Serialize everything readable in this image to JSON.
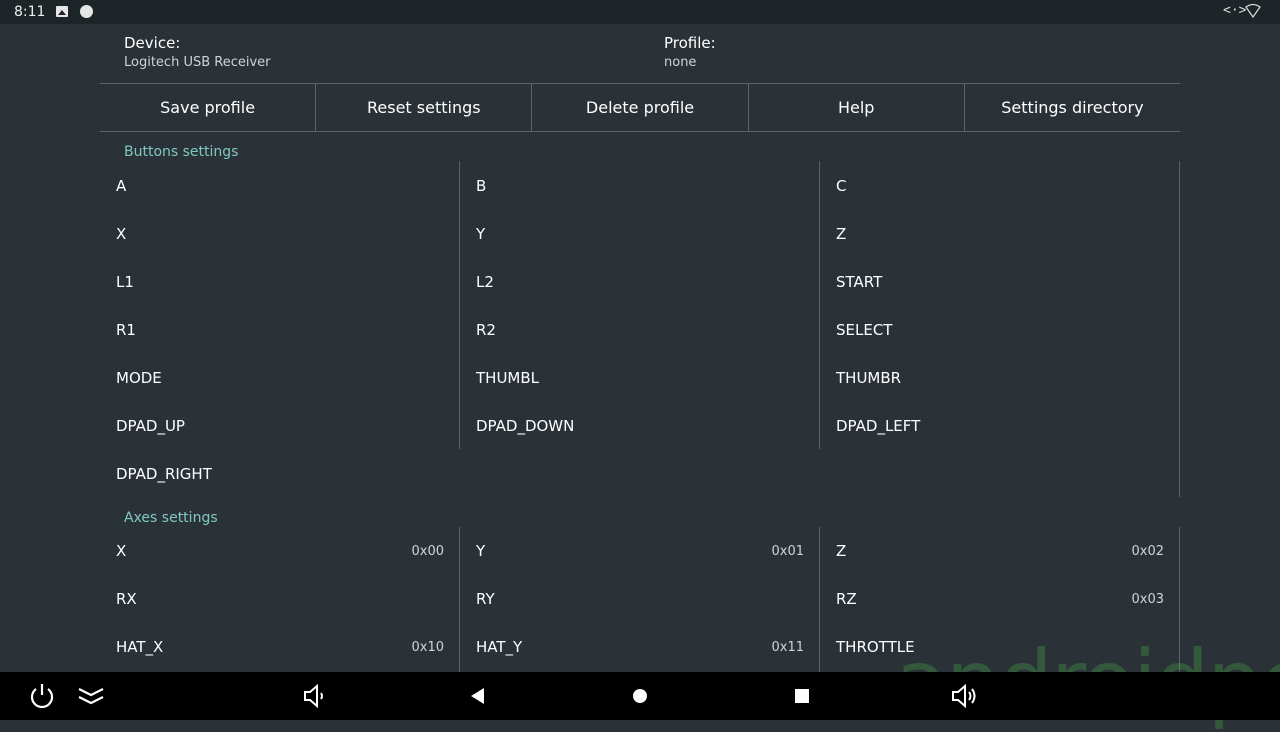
{
  "status_bar": {
    "time": "8:11",
    "code_icon": "<·>"
  },
  "header": {
    "device_label": "Device:",
    "device_value": "Logitech USB Receiver",
    "profile_label": "Profile:",
    "profile_value": "none"
  },
  "toolbar": {
    "buttons": [
      "Save profile",
      "Reset settings",
      "Delete profile",
      "Help",
      "Settings directory"
    ]
  },
  "buttons_section": {
    "title": "Buttons settings",
    "col1": [
      "A",
      "X",
      "L1",
      "R1",
      "MODE",
      "DPAD_UP",
      "DPAD_RIGHT"
    ],
    "col2": [
      "B",
      "Y",
      "L2",
      "R2",
      "THUMBL",
      "DPAD_DOWN"
    ],
    "col3": [
      "C",
      "Z",
      "START",
      "SELECT",
      "THUMBR",
      "DPAD_LEFT"
    ]
  },
  "axes_section": {
    "title": "Axes settings",
    "col1": [
      {
        "name": "X",
        "code": "0x00"
      },
      {
        "name": "RX",
        "code": ""
      },
      {
        "name": "HAT_X",
        "code": "0x10"
      }
    ],
    "col2": [
      {
        "name": "Y",
        "code": "0x01"
      },
      {
        "name": "RY",
        "code": ""
      },
      {
        "name": "HAT_Y",
        "code": "0x11"
      }
    ],
    "col3": [
      {
        "name": "Z",
        "code": "0x02"
      },
      {
        "name": "RZ",
        "code": "0x03"
      },
      {
        "name": "THROTTLE",
        "code": ""
      }
    ]
  },
  "watermark": "androidpc",
  "colors": {
    "background": "#2a3238",
    "accent": "#7fc9bf",
    "divider": "#5b6469"
  }
}
